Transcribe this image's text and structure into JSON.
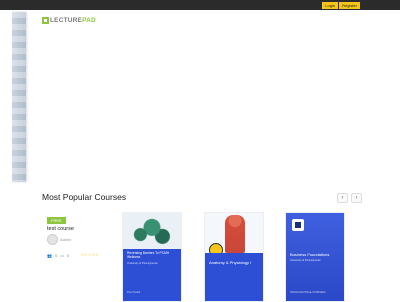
{
  "header": {
    "login_label": "Login",
    "register_label": "Register",
    "logo": {
      "lecture": "LECTURE",
      "pad": "PAD"
    }
  },
  "popular": {
    "title": "Most Popular Courses",
    "prev_icon": "chevron-left-icon",
    "next_icon": "chevron-right-icon"
  },
  "courses": [
    {
      "badge": "FREE",
      "name": "test course",
      "author": "Admin",
      "students": "0",
      "lessons": "0",
      "rating_stars": "☆☆☆☆☆"
    },
    {
      "title": "Reversing Barriers To PCMH Wellness",
      "subtitle": "University of Pennsylvania",
      "footer": "Penn Health"
    },
    {
      "title": "Anatomy & Physiology I"
    },
    {
      "title": "Business Foundations",
      "subtitle": "University of Pennsylvania",
      "footer": "SPECIALIZATION ■ COURSERA"
    }
  ],
  "colors": {
    "accent": "#8cc63f",
    "auth": "#f5c518",
    "card_blue": "#2d4fd6"
  }
}
